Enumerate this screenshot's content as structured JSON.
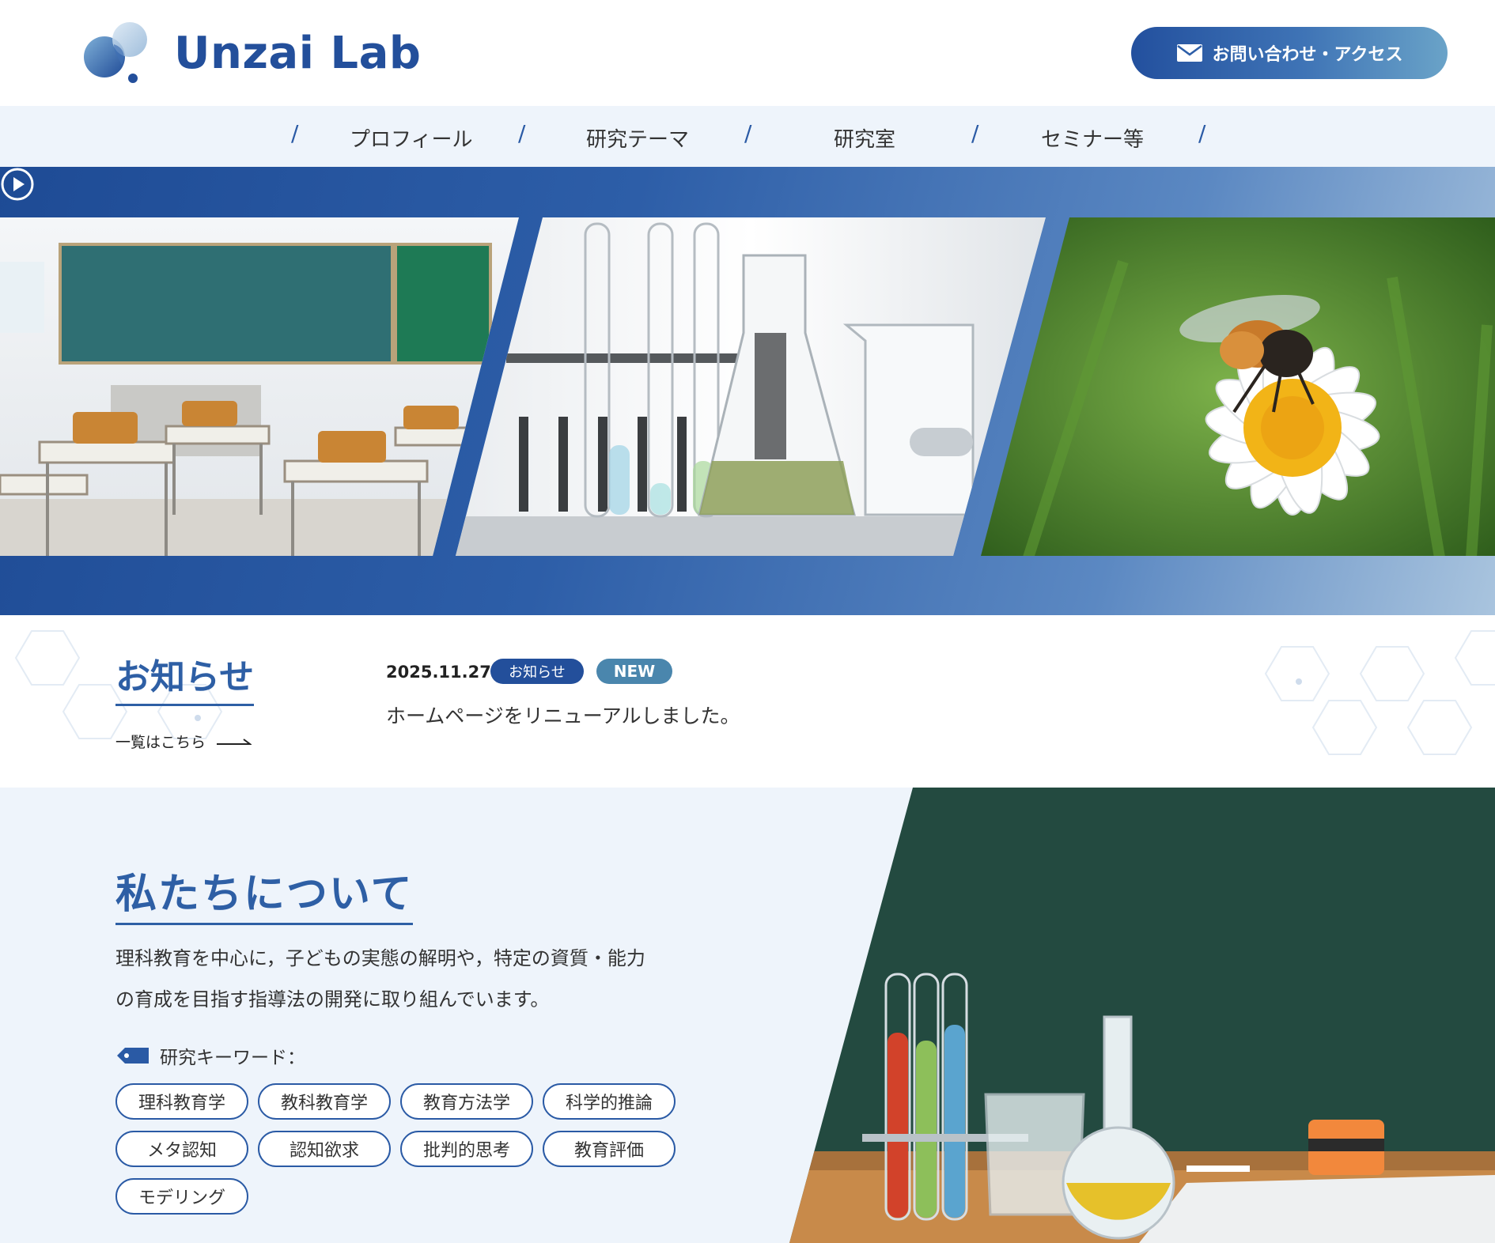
{
  "header": {
    "logo_text": "Unzai Lab",
    "contact_label": "お問い合わせ・アクセス"
  },
  "nav": {
    "items": [
      {
        "label": "プロフィール"
      },
      {
        "label": "研究テーマ"
      },
      {
        "label": "研究室"
      },
      {
        "label": "セミナー等"
      }
    ],
    "separator": "/"
  },
  "hero": {
    "slides": [
      {
        "subject": "classroom"
      },
      {
        "subject": "laboratory glassware"
      },
      {
        "subject": "bee on daisy"
      }
    ],
    "play_icon": "play-circle-icon"
  },
  "news": {
    "title": "お知らせ",
    "list_link": "一覧はこちら",
    "items": [
      {
        "date": "2025.11.27",
        "category": "お知らせ",
        "badge": "NEW",
        "text": "ホームページをリニューアルしました。"
      }
    ]
  },
  "about": {
    "title": "私たちについて",
    "description_lines": [
      "理科教育を中心に，子どもの実態の解明や，特定の資質・能力",
      "の育成を目指す指導法の開発に取り組んでいます。"
    ],
    "keywords_label": "研究キーワード：",
    "keywords": [
      "理科教育学",
      "教科教育学",
      "教育方法学",
      "科学的推論",
      "メタ認知",
      "認知欲求",
      "批判的思考",
      "教育評価",
      "モデリング"
    ]
  },
  "colors": {
    "brand": "#234f9b",
    "accent": "#4a86ad",
    "background_light": "#eef4fb"
  }
}
